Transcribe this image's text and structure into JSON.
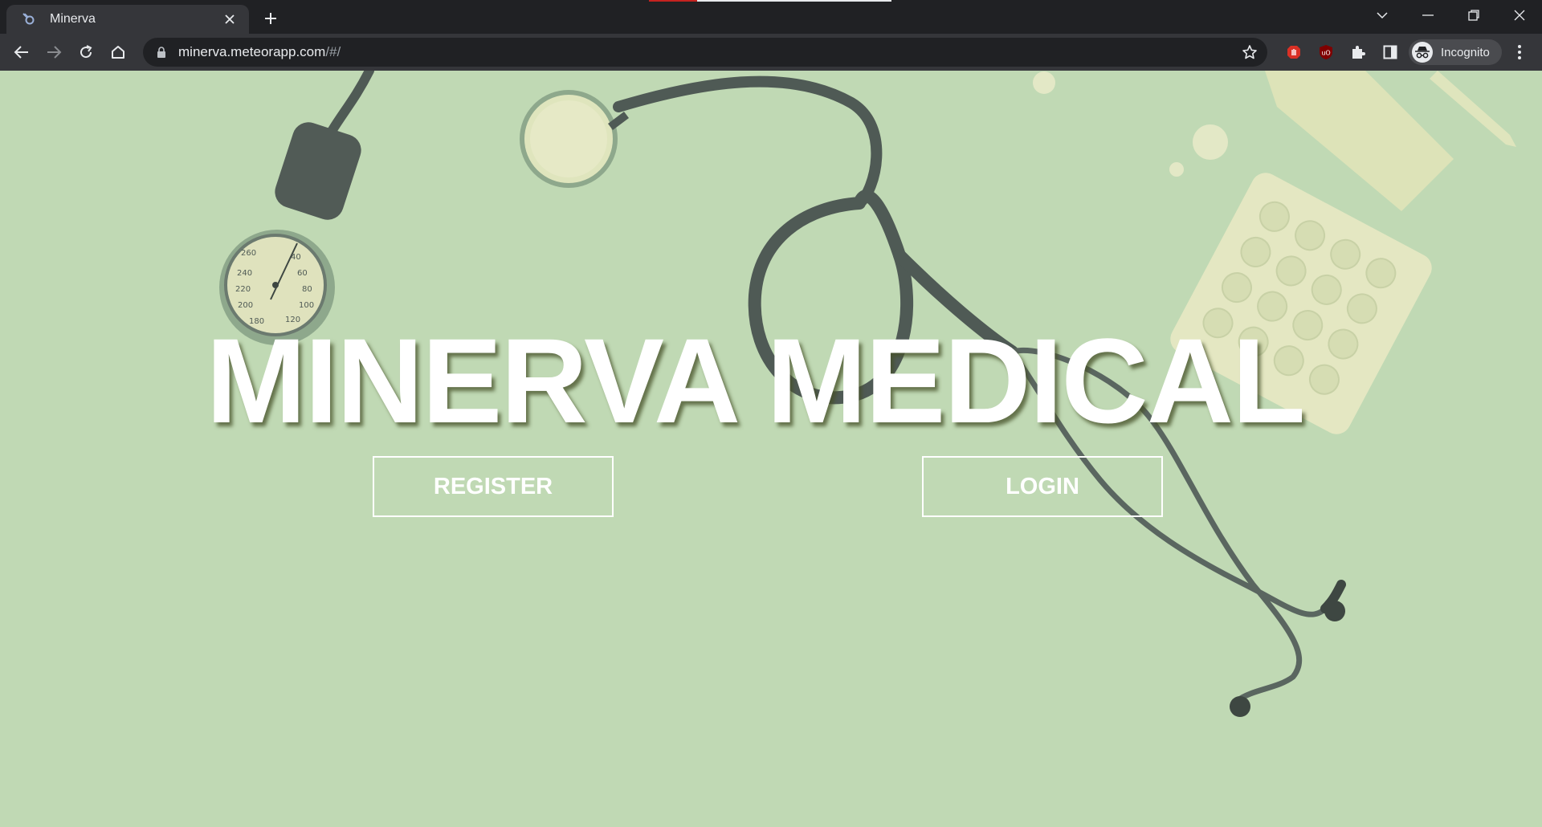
{
  "browser": {
    "tab": {
      "title": "Minerva",
      "close_icon": "close-icon",
      "favicon": "meteor-favicon-icon"
    },
    "new_tab_icon": "plus-icon",
    "address": {
      "host": "minerva.meteorapp.com",
      "path": "/#/"
    },
    "profile": {
      "label": "Incognito"
    },
    "colors": {
      "frame": "#202124",
      "toolbar": "#35363a",
      "text": "#e8eaed"
    }
  },
  "page": {
    "title": "MINERVA MEDICAL",
    "register_label": "REGISTER",
    "login_label": "LOGIN",
    "colors": {
      "background": "#c0d9b4",
      "text": "#ffffff"
    }
  }
}
